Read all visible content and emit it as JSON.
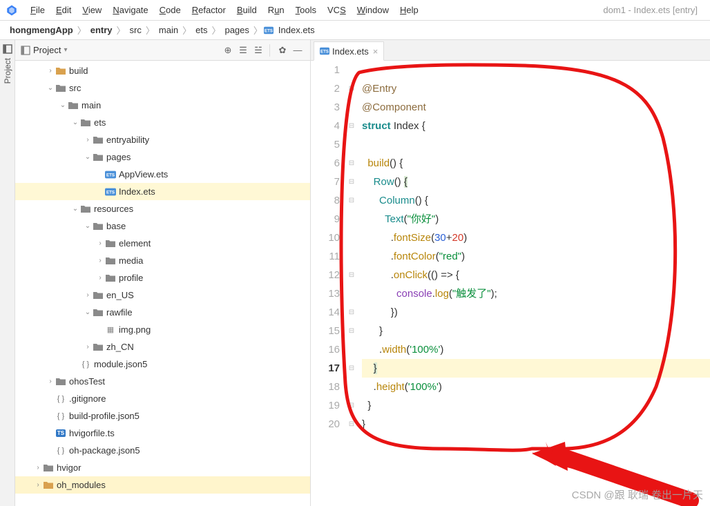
{
  "window_title": "dom1 - Index.ets [entry]",
  "menu": {
    "file": "File",
    "edit": "Edit",
    "view": "View",
    "navigate": "Navigate",
    "code": "Code",
    "refactor": "Refactor",
    "build": "Build",
    "run": "Run",
    "tools": "Tools",
    "vcs": "VCS",
    "window": "Window",
    "help": "Help"
  },
  "breadcrumb": [
    "hongmengApp",
    "entry",
    "src",
    "main",
    "ets",
    "pages",
    "Index.ets"
  ],
  "side_tab": "Project",
  "panel": {
    "title": "Project"
  },
  "tree": [
    {
      "d": 2,
      "a": "r",
      "t": "folder-orange",
      "l": "build"
    },
    {
      "d": 2,
      "a": "d",
      "t": "folder",
      "l": "src"
    },
    {
      "d": 3,
      "a": "d",
      "t": "folder",
      "l": "main"
    },
    {
      "d": 4,
      "a": "d",
      "t": "folder",
      "l": "ets"
    },
    {
      "d": 5,
      "a": "r",
      "t": "folder",
      "l": "entryability"
    },
    {
      "d": 5,
      "a": "d",
      "t": "folder",
      "l": "pages"
    },
    {
      "d": 6,
      "a": "",
      "t": "ets",
      "l": "AppView.ets"
    },
    {
      "d": 6,
      "a": "",
      "t": "ets",
      "l": "Index.ets",
      "sel": true
    },
    {
      "d": 4,
      "a": "d",
      "t": "folder",
      "l": "resources"
    },
    {
      "d": 5,
      "a": "d",
      "t": "folder",
      "l": "base"
    },
    {
      "d": 6,
      "a": "r",
      "t": "folder",
      "l": "element"
    },
    {
      "d": 6,
      "a": "r",
      "t": "folder",
      "l": "media"
    },
    {
      "d": 6,
      "a": "r",
      "t": "folder",
      "l": "profile"
    },
    {
      "d": 5,
      "a": "r",
      "t": "folder",
      "l": "en_US"
    },
    {
      "d": 5,
      "a": "d",
      "t": "folder",
      "l": "rawfile"
    },
    {
      "d": 6,
      "a": "",
      "t": "img",
      "l": "img.png"
    },
    {
      "d": 5,
      "a": "r",
      "t": "folder",
      "l": "zh_CN"
    },
    {
      "d": 4,
      "a": "",
      "t": "json",
      "l": "module.json5"
    },
    {
      "d": 2,
      "a": "r",
      "t": "folder",
      "l": "ohosTest"
    },
    {
      "d": 2,
      "a": "",
      "t": "json",
      "l": ".gitignore"
    },
    {
      "d": 2,
      "a": "",
      "t": "json",
      "l": "build-profile.json5"
    },
    {
      "d": 2,
      "a": "",
      "t": "ts",
      "l": "hvigorfile.ts"
    },
    {
      "d": 2,
      "a": "",
      "t": "json",
      "l": "oh-package.json5"
    },
    {
      "d": 1,
      "a": "r",
      "t": "folder",
      "l": "hvigor"
    },
    {
      "d": 1,
      "a": "r",
      "t": "folder-orange",
      "l": "oh_modules",
      "hl": true
    }
  ],
  "tab": {
    "label": "Index.ets"
  },
  "code": {
    "lines": 20,
    "active_line": 17,
    "l2_entry": "@Entry",
    "l3_component": "@Component",
    "l4_struct": "struct",
    "l4_name": "Index",
    "l6_build": "build",
    "l7_row": "Row",
    "l8_col": "Column",
    "l9_text": "Text",
    "l9_str": "\"你好\"",
    "l10_fsize": "fontSize",
    "l10_n1": "30",
    "l10_n2": "20",
    "l11_fcolor": "fontColor",
    "l11_str": "\"red\"",
    "l12_onclick": "onClick",
    "l13_console": "console",
    "l13_log": "log",
    "l13_str": "\"触发了\"",
    "l16_width": "width",
    "l16_str": "'100%'",
    "l18_height": "height",
    "l18_str": "'100%'"
  },
  "watermark": "CSDN @跟 耿瑞 卷出一片天"
}
